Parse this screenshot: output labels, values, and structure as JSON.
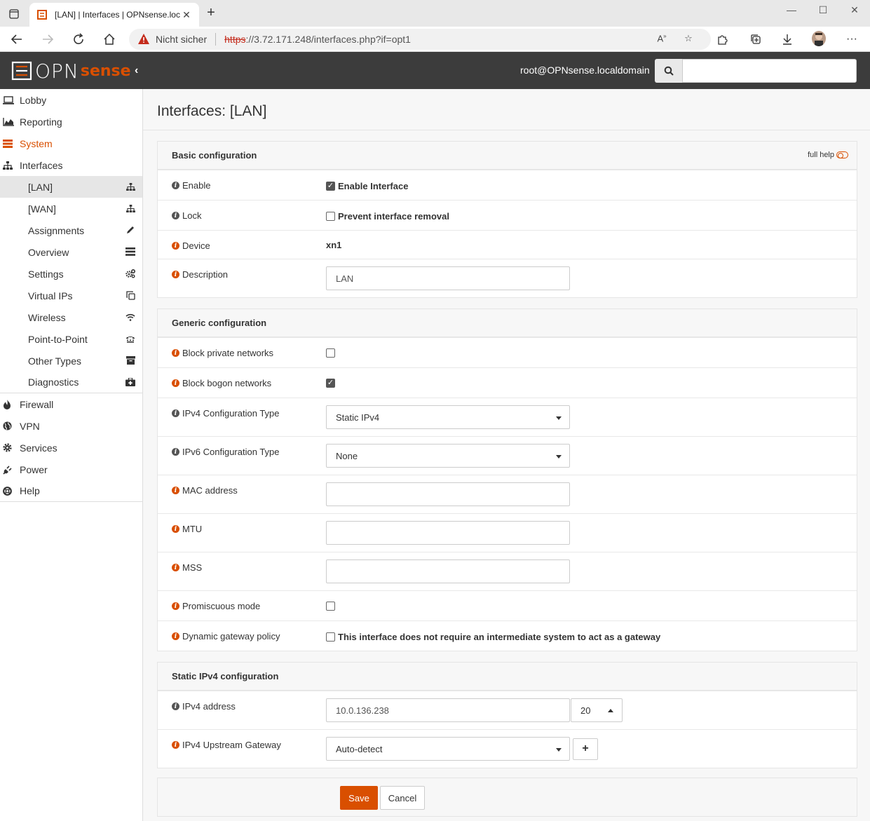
{
  "browser": {
    "tab_title": "[LAN] | Interfaces | OPNsense.loc",
    "security_label": "Nicht sicher",
    "url_scheme": "https",
    "url_rest": "://3.72.171.248/interfaces.php?if=opt1"
  },
  "header": {
    "logo_text": "OPN",
    "logo_brand": "sense",
    "user": "root@OPNsense.localdomain",
    "search_placeholder": ""
  },
  "sidebar": {
    "items": [
      {
        "label": "Lobby",
        "icon": "laptop-icon"
      },
      {
        "label": "Reporting",
        "icon": "area-chart-icon"
      },
      {
        "label": "System",
        "icon": "server-icon"
      },
      {
        "label": "Interfaces",
        "icon": "sitemap-icon"
      }
    ],
    "interfaces_sub": [
      {
        "label": "[LAN]",
        "icon": "sitemap-icon"
      },
      {
        "label": "[WAN]",
        "icon": "sitemap-icon"
      },
      {
        "label": "Assignments",
        "icon": "pencil-icon"
      },
      {
        "label": "Overview",
        "icon": "tasks-icon"
      },
      {
        "label": "Settings",
        "icon": "cogs-icon"
      },
      {
        "label": "Virtual IPs",
        "icon": "clone-icon"
      },
      {
        "label": "Wireless",
        "icon": "wifi-icon"
      },
      {
        "label": "Point-to-Point",
        "icon": "tty-icon"
      },
      {
        "label": "Other Types",
        "icon": "archive-icon"
      },
      {
        "label": "Diagnostics",
        "icon": "medkit-icon"
      }
    ],
    "rest": [
      {
        "label": "Firewall",
        "icon": "fire-icon"
      },
      {
        "label": "VPN",
        "icon": "globe-icon"
      },
      {
        "label": "Services",
        "icon": "cog-icon"
      },
      {
        "label": "Power",
        "icon": "plug-icon"
      },
      {
        "label": "Help",
        "icon": "life-ring-icon"
      }
    ]
  },
  "page": {
    "title": "Interfaces: [LAN]"
  },
  "basic": {
    "heading": "Basic configuration",
    "full_help": "full help",
    "enable_label": "Enable",
    "enable_text": "Enable Interface",
    "lock_label": "Lock",
    "lock_text": "Prevent interface removal",
    "device_label": "Device",
    "device_value": "xn1",
    "description_label": "Description",
    "description_value": "LAN"
  },
  "generic": {
    "heading": "Generic configuration",
    "block_private_label": "Block private networks",
    "block_bogon_label": "Block bogon networks",
    "ipv4_type_label": "IPv4 Configuration Type",
    "ipv4_type_value": "Static IPv4",
    "ipv6_type_label": "IPv6 Configuration Type",
    "ipv6_type_value": "None",
    "mac_label": "MAC address",
    "mac_value": "",
    "mtu_label": "MTU",
    "mtu_value": "",
    "mss_label": "MSS",
    "mss_value": "",
    "promisc_label": "Promiscuous mode",
    "dyngw_label": "Dynamic gateway policy",
    "dyngw_text": "This interface does not require an intermediate system to act as a gateway"
  },
  "static4": {
    "heading": "Static IPv4 configuration",
    "addr_label": "IPv4 address",
    "addr_value": "10.0.136.238",
    "mask_value": "20",
    "gw_label": "IPv4 Upstream Gateway",
    "gw_value": "Auto-detect"
  },
  "actions": {
    "save": "Save",
    "cancel": "Cancel"
  },
  "colors": {
    "accent": "#d94f00",
    "header_bg": "#3c3c3c"
  }
}
